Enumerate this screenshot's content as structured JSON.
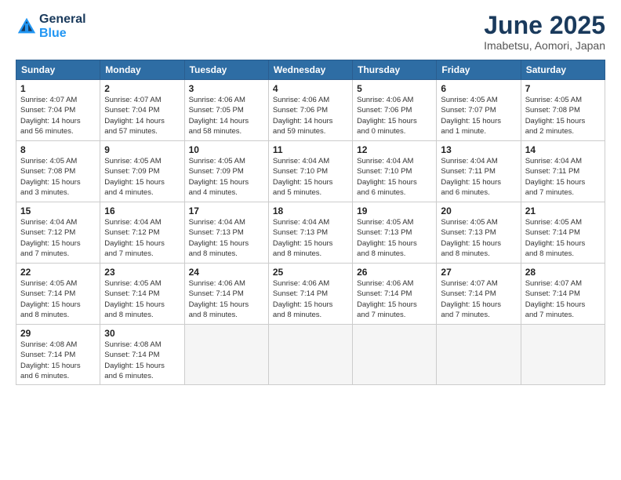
{
  "header": {
    "logo_line1": "General",
    "logo_line2": "Blue",
    "month_title": "June 2025",
    "subtitle": "Imabetsu, Aomori, Japan"
  },
  "weekdays": [
    "Sunday",
    "Monday",
    "Tuesday",
    "Wednesday",
    "Thursday",
    "Friday",
    "Saturday"
  ],
  "weeks": [
    [
      {
        "day": "1",
        "info": "Sunrise: 4:07 AM\nSunset: 7:04 PM\nDaylight: 14 hours\nand 56 minutes."
      },
      {
        "day": "2",
        "info": "Sunrise: 4:07 AM\nSunset: 7:04 PM\nDaylight: 14 hours\nand 57 minutes."
      },
      {
        "day": "3",
        "info": "Sunrise: 4:06 AM\nSunset: 7:05 PM\nDaylight: 14 hours\nand 58 minutes."
      },
      {
        "day": "4",
        "info": "Sunrise: 4:06 AM\nSunset: 7:06 PM\nDaylight: 14 hours\nand 59 minutes."
      },
      {
        "day": "5",
        "info": "Sunrise: 4:06 AM\nSunset: 7:06 PM\nDaylight: 15 hours\nand 0 minutes."
      },
      {
        "day": "6",
        "info": "Sunrise: 4:05 AM\nSunset: 7:07 PM\nDaylight: 15 hours\nand 1 minute."
      },
      {
        "day": "7",
        "info": "Sunrise: 4:05 AM\nSunset: 7:08 PM\nDaylight: 15 hours\nand 2 minutes."
      }
    ],
    [
      {
        "day": "8",
        "info": "Sunrise: 4:05 AM\nSunset: 7:08 PM\nDaylight: 15 hours\nand 3 minutes."
      },
      {
        "day": "9",
        "info": "Sunrise: 4:05 AM\nSunset: 7:09 PM\nDaylight: 15 hours\nand 4 minutes."
      },
      {
        "day": "10",
        "info": "Sunrise: 4:05 AM\nSunset: 7:09 PM\nDaylight: 15 hours\nand 4 minutes."
      },
      {
        "day": "11",
        "info": "Sunrise: 4:04 AM\nSunset: 7:10 PM\nDaylight: 15 hours\nand 5 minutes."
      },
      {
        "day": "12",
        "info": "Sunrise: 4:04 AM\nSunset: 7:10 PM\nDaylight: 15 hours\nand 6 minutes."
      },
      {
        "day": "13",
        "info": "Sunrise: 4:04 AM\nSunset: 7:11 PM\nDaylight: 15 hours\nand 6 minutes."
      },
      {
        "day": "14",
        "info": "Sunrise: 4:04 AM\nSunset: 7:11 PM\nDaylight: 15 hours\nand 7 minutes."
      }
    ],
    [
      {
        "day": "15",
        "info": "Sunrise: 4:04 AM\nSunset: 7:12 PM\nDaylight: 15 hours\nand 7 minutes."
      },
      {
        "day": "16",
        "info": "Sunrise: 4:04 AM\nSunset: 7:12 PM\nDaylight: 15 hours\nand 7 minutes."
      },
      {
        "day": "17",
        "info": "Sunrise: 4:04 AM\nSunset: 7:13 PM\nDaylight: 15 hours\nand 8 minutes."
      },
      {
        "day": "18",
        "info": "Sunrise: 4:04 AM\nSunset: 7:13 PM\nDaylight: 15 hours\nand 8 minutes."
      },
      {
        "day": "19",
        "info": "Sunrise: 4:05 AM\nSunset: 7:13 PM\nDaylight: 15 hours\nand 8 minutes."
      },
      {
        "day": "20",
        "info": "Sunrise: 4:05 AM\nSunset: 7:13 PM\nDaylight: 15 hours\nand 8 minutes."
      },
      {
        "day": "21",
        "info": "Sunrise: 4:05 AM\nSunset: 7:14 PM\nDaylight: 15 hours\nand 8 minutes."
      }
    ],
    [
      {
        "day": "22",
        "info": "Sunrise: 4:05 AM\nSunset: 7:14 PM\nDaylight: 15 hours\nand 8 minutes."
      },
      {
        "day": "23",
        "info": "Sunrise: 4:05 AM\nSunset: 7:14 PM\nDaylight: 15 hours\nand 8 minutes."
      },
      {
        "day": "24",
        "info": "Sunrise: 4:06 AM\nSunset: 7:14 PM\nDaylight: 15 hours\nand 8 minutes."
      },
      {
        "day": "25",
        "info": "Sunrise: 4:06 AM\nSunset: 7:14 PM\nDaylight: 15 hours\nand 8 minutes."
      },
      {
        "day": "26",
        "info": "Sunrise: 4:06 AM\nSunset: 7:14 PM\nDaylight: 15 hours\nand 7 minutes."
      },
      {
        "day": "27",
        "info": "Sunrise: 4:07 AM\nSunset: 7:14 PM\nDaylight: 15 hours\nand 7 minutes."
      },
      {
        "day": "28",
        "info": "Sunrise: 4:07 AM\nSunset: 7:14 PM\nDaylight: 15 hours\nand 7 minutes."
      }
    ],
    [
      {
        "day": "29",
        "info": "Sunrise: 4:08 AM\nSunset: 7:14 PM\nDaylight: 15 hours\nand 6 minutes."
      },
      {
        "day": "30",
        "info": "Sunrise: 4:08 AM\nSunset: 7:14 PM\nDaylight: 15 hours\nand 6 minutes."
      },
      {
        "day": "",
        "info": ""
      },
      {
        "day": "",
        "info": ""
      },
      {
        "day": "",
        "info": ""
      },
      {
        "day": "",
        "info": ""
      },
      {
        "day": "",
        "info": ""
      }
    ]
  ]
}
